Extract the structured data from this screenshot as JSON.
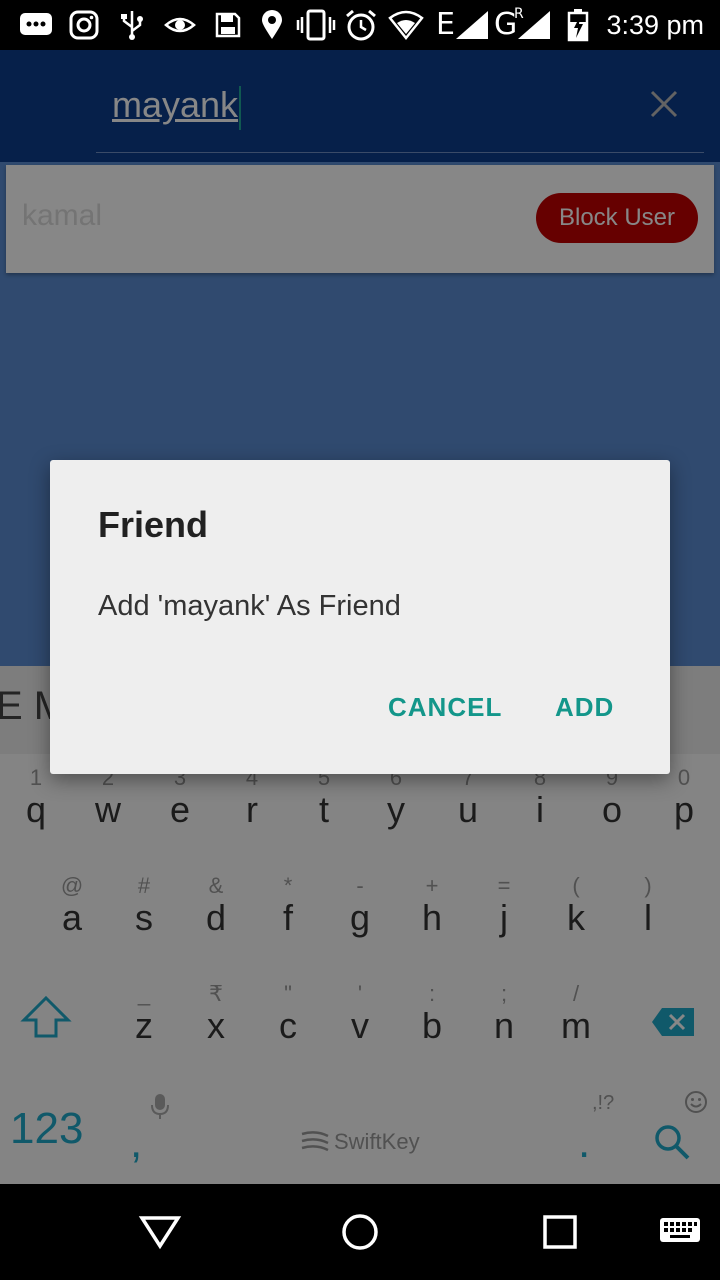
{
  "status_bar": {
    "time": "3:39 pm",
    "network_label_e": "E",
    "network_label_g": "G",
    "roaming": "R",
    "icons": [
      "message-icon",
      "instagram-icon",
      "usb-icon",
      "eye-icon",
      "save-icon",
      "location-icon",
      "vibrate-icon",
      "alarm-icon",
      "wifi-icon",
      "signal-icon",
      "signal-icon",
      "battery-icon"
    ]
  },
  "search": {
    "query": "mayank",
    "clear_icon": "close-icon"
  },
  "result": {
    "name": "kamal",
    "block_label": "Block User"
  },
  "colors": {
    "toolbar": "#0d3d8c",
    "background": "#5b8dd2",
    "accent": "#13968a",
    "block_button": "#c00000"
  },
  "dialog": {
    "title": "Friend",
    "message": "Add 'mayank' As Friend",
    "cancel_label": "CANCEL",
    "add_label": "ADD"
  },
  "keyboard": {
    "suggestion": "E M",
    "row1": [
      {
        "key": "q",
        "hint": "1"
      },
      {
        "key": "w",
        "hint": "2"
      },
      {
        "key": "e",
        "hint": "3"
      },
      {
        "key": "r",
        "hint": "4"
      },
      {
        "key": "t",
        "hint": "5"
      },
      {
        "key": "y",
        "hint": "6"
      },
      {
        "key": "u",
        "hint": "7"
      },
      {
        "key": "i",
        "hint": "8"
      },
      {
        "key": "o",
        "hint": "9"
      },
      {
        "key": "p",
        "hint": "0"
      }
    ],
    "row2": [
      {
        "key": "a",
        "hint": "@"
      },
      {
        "key": "s",
        "hint": "#"
      },
      {
        "key": "d",
        "hint": "&"
      },
      {
        "key": "f",
        "hint": "*"
      },
      {
        "key": "g",
        "hint": "-"
      },
      {
        "key": "h",
        "hint": "+"
      },
      {
        "key": "j",
        "hint": "="
      },
      {
        "key": "k",
        "hint": "("
      },
      {
        "key": "l",
        "hint": ")"
      }
    ],
    "row3": [
      {
        "key": "z",
        "hint": "_"
      },
      {
        "key": "x",
        "hint": "₹"
      },
      {
        "key": "c",
        "hint": "\""
      },
      {
        "key": "v",
        "hint": "'"
      },
      {
        "key": "b",
        "hint": ":"
      },
      {
        "key": "n",
        "hint": ";"
      },
      {
        "key": "m",
        "hint": "/"
      }
    ],
    "numbers_label": "123",
    "comma": ",",
    "period": ".",
    "period_hint": ",!?",
    "brand": "SwiftKey",
    "icons": [
      "shift-icon",
      "backspace-icon",
      "mic-icon",
      "emoji-icon",
      "search-icon"
    ]
  },
  "nav_bar": {
    "icons": [
      "back-icon",
      "home-icon",
      "recents-icon",
      "keyboard-icon"
    ]
  }
}
